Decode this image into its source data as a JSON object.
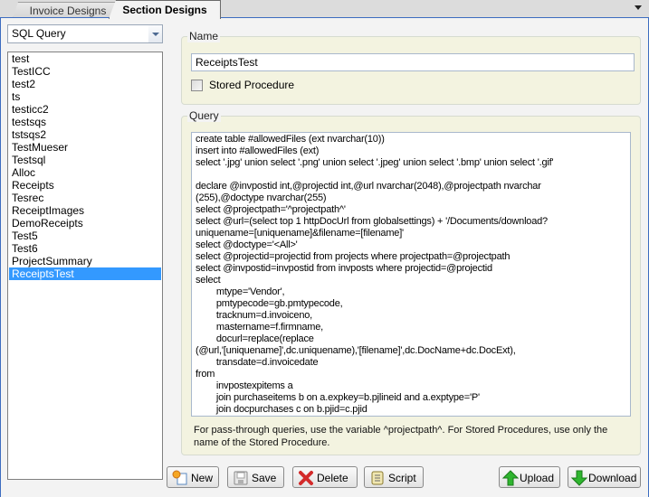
{
  "tabs": [
    {
      "label": "Invoice Designs",
      "active": false
    },
    {
      "label": "Section Designs",
      "active": true
    }
  ],
  "type_select": {
    "value": "SQL Query"
  },
  "designs_list": {
    "items": [
      "test",
      "TestICC",
      "test2",
      "ts",
      "testicc2",
      "testsqs",
      "tstsqs2",
      "TestMueser",
      "Testsql",
      "Alloc",
      "Receipts",
      "Tesrec",
      "ReceiptImages",
      "DemoReceipts",
      "Test5",
      "Test6",
      "ProjectSummary",
      "ReceiptsTest"
    ],
    "selected": "ReceiptsTest"
  },
  "name_group": {
    "title": "Name",
    "name_value": "ReceiptsTest",
    "stored_procedure_label": "Stored Procedure",
    "stored_procedure_checked": false
  },
  "query_group": {
    "title": "Query",
    "query_text": "create table #allowedFiles (ext nvarchar(10))\ninsert into #allowedFiles (ext)\nselect '.jpg' union select '.png' union select '.jpeg' union select '.bmp' union select '.gif'\n\ndeclare @invpostid int,@projectid int,@url nvarchar(2048),@projectpath nvarchar\n(255),@doctype nvarchar(255)\nselect @projectpath='^projectpath^'\nselect @url=(select top 1 httpDocUrl from globalsettings) + '/Documents/download?\nuniquename=[uniquename]&filename=[filename]'\nselect @doctype='<All>'\nselect @projectid=projectid from projects where projectpath=@projectpath\nselect @invpostid=invpostid from invposts where projectid=@projectid\nselect\n\t\tmtype='Vendor',\n\t\tpmtypecode=gb.pmtypecode,\n\t\ttracknum=d.invoiceno,\n\t\tmastername=f.firmname,\n\t\tdocurl=replace(replace\n(@url,'[uniquename]',dc.uniquename),'[filename]',dc.DocName+dc.DocExt),\n\t\ttransdate=d.invoicedate\nfrom\n\t\tinvpostexpitems a\n\t\tjoin purchaseitems b on a.expkey=b.pjlineid and a.exptype='P'\n\t\tjoin docpurchases c on b.pjid=c.pjid\n\t\tjoin purchases d on b.pjid=d.pjid",
    "help_text": "For pass-through queries, use the variable ^projectpath^.  For Stored Procedures, use only the name of the Stored Procedure."
  },
  "buttons": {
    "new": "New",
    "save": "Save",
    "delete": "Delete",
    "script": "Script",
    "upload": "Upload",
    "download": "Download"
  }
}
